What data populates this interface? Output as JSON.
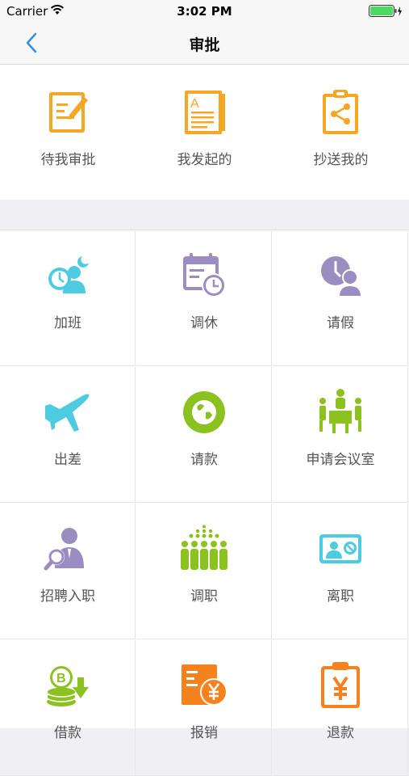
{
  "status_bar": {
    "carrier": "Carrier",
    "time": "3:02 PM"
  },
  "nav": {
    "title": "审批"
  },
  "top_items": [
    {
      "label": "待我审批",
      "icon": "edit-document-icon"
    },
    {
      "label": "我发起的",
      "icon": "document-a-icon"
    },
    {
      "label": "抄送我的",
      "icon": "clipboard-share-icon"
    }
  ],
  "grid_items": [
    {
      "label": "加班",
      "icon": "overtime-icon"
    },
    {
      "label": "调休",
      "icon": "calendar-clock-icon"
    },
    {
      "label": "请假",
      "icon": "leave-clock-person-icon"
    },
    {
      "label": "出差",
      "icon": "airplane-icon"
    },
    {
      "label": "请款",
      "icon": "globe-icon"
    },
    {
      "label": "申请会议室",
      "icon": "meeting-room-icon"
    },
    {
      "label": "招聘入职",
      "icon": "recruit-search-person-icon"
    },
    {
      "label": "调职",
      "icon": "transfer-people-icon"
    },
    {
      "label": "离职",
      "icon": "resign-id-card-icon"
    },
    {
      "label": "借款",
      "icon": "borrow-coins-icon"
    },
    {
      "label": "报销",
      "icon": "reimburse-yen-icon"
    },
    {
      "label": "退款",
      "icon": "refund-clipboard-yen-icon"
    }
  ],
  "colors": {
    "orange": "#f5a623",
    "cyan": "#4dcbe0",
    "purple": "#9b8dc1",
    "green": "#8cc21f",
    "deep_orange": "#f5821f",
    "back_arrow": "#2f8fe0"
  }
}
